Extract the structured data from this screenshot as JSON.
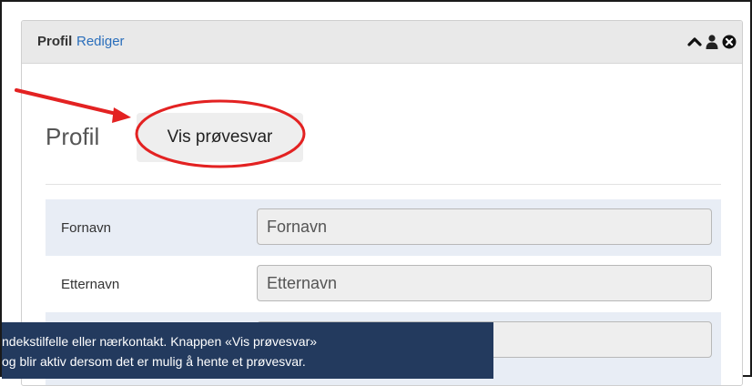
{
  "panel": {
    "title": "Profil",
    "edit_link": "Rediger",
    "icons": [
      "chevron-up-icon",
      "user-icon",
      "close-circle-icon"
    ]
  },
  "profile": {
    "heading": "Profil",
    "show_results_button": "Vis prøvesvar"
  },
  "fields": [
    {
      "label": "Fornavn",
      "placeholder": "Fornavn"
    },
    {
      "label": "Etternavn",
      "placeholder": "Etternavn"
    },
    {
      "label": "",
      "placeholder": ""
    }
  ],
  "callout": {
    "line1": "ndekstilfelle eller nærkontakt. Knappen «Vis prøvesvar»",
    "line2": "og blir aktiv dersom det er mulig å hente et prøvesvar."
  },
  "colors": {
    "annotation": "#e32222",
    "link": "#2a6ebb",
    "callout_bg": "#233a5e",
    "row_shade": "#e8edf5"
  }
}
